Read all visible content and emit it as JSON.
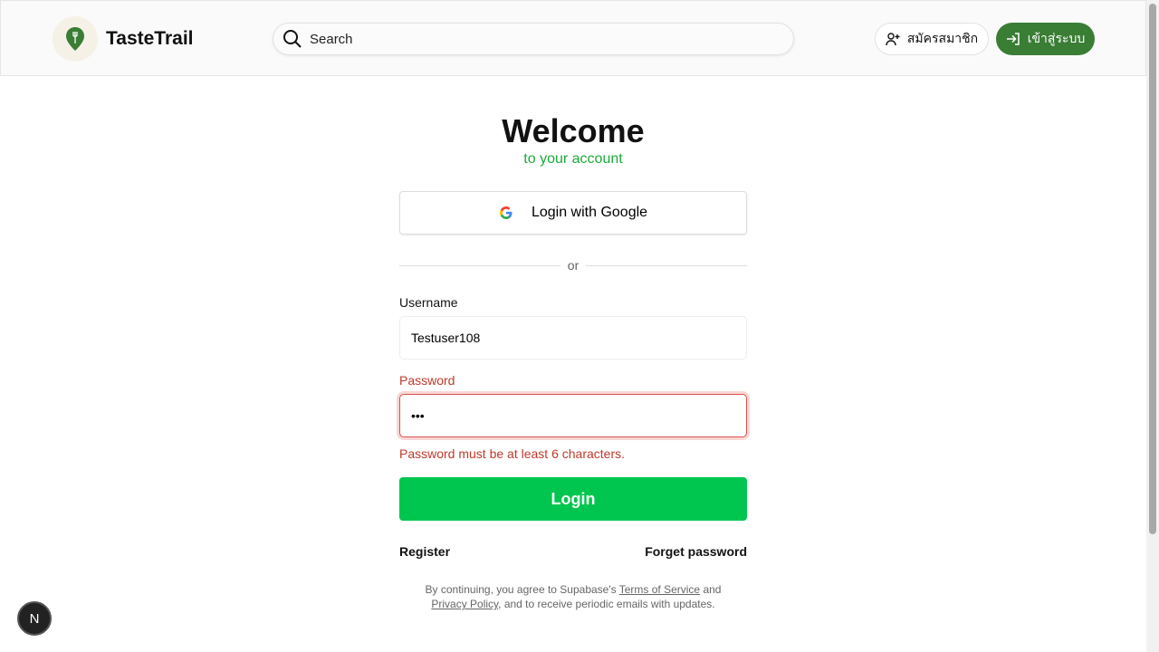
{
  "header": {
    "brand": "TasteTrail",
    "search_placeholder": "Search",
    "register_label": "สมัครสมาชิก",
    "login_label": "เข้าสู่ระบบ",
    "accent": "#3a7d35"
  },
  "main": {
    "title": "Welcome",
    "subtitle": "to your account",
    "google_label": "Login with Google",
    "or": "or",
    "username_label": "Username",
    "username_value": "Testuser108",
    "password_label": "Password",
    "password_value": "•••",
    "error": "Password must be at least 6 characters.",
    "login_button": "Login",
    "register_link": "Register",
    "forgot_link": "Forget password",
    "terms": {
      "pre": "By continuing, you agree to Supabase's ",
      "tos": "Terms of Service",
      "mid": " and ",
      "privacy": "Privacy Policy",
      "post": ", and to receive periodic emails with updates."
    }
  },
  "badge": "N"
}
